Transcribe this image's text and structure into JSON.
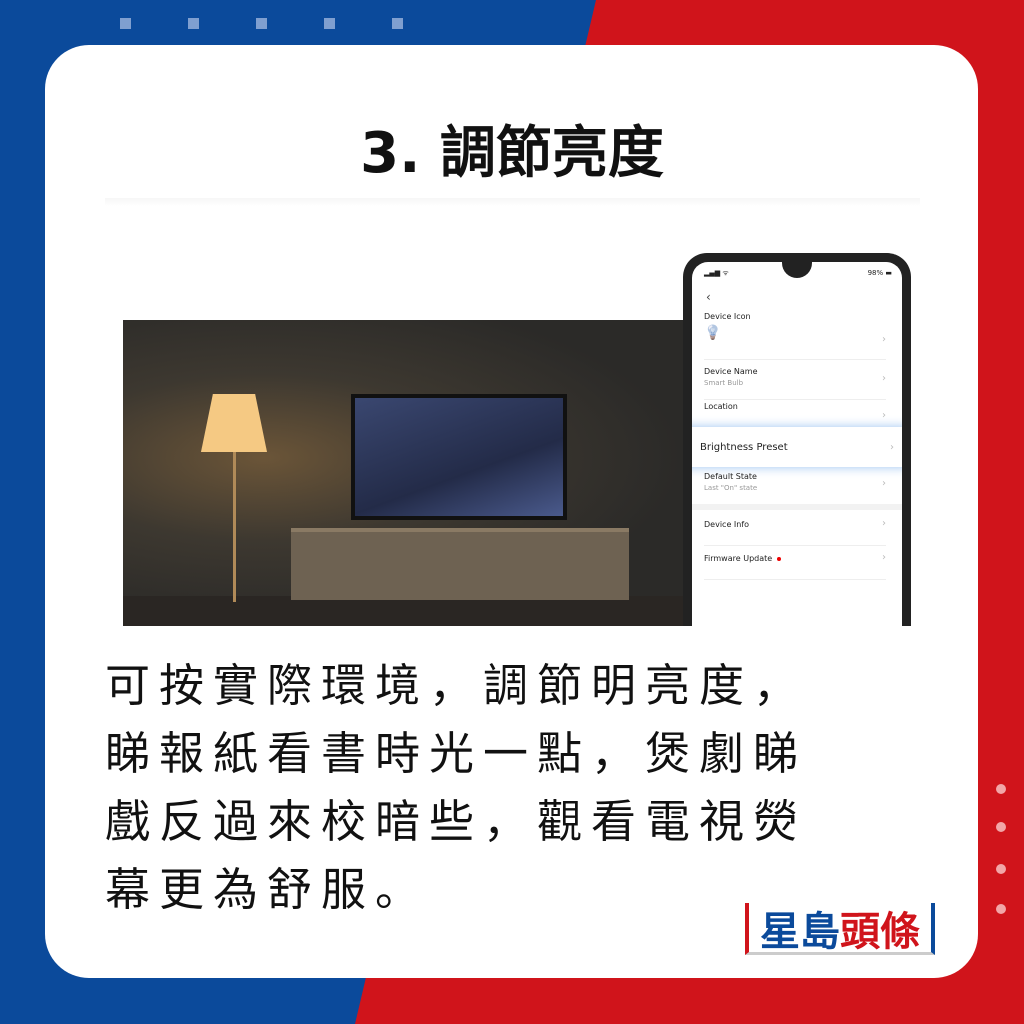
{
  "title": "3.  調節亮度",
  "body_lines": [
    "可按實際環境，調節明亮度，",
    "睇報紙看書時光一點，煲劇睇",
    "戲反過來校暗些，觀看電視熒",
    "幕更為舒服。"
  ],
  "phone": {
    "signal": "▂▄▆ ᯤ",
    "battery": "98% ▬",
    "back": "‹",
    "items": [
      {
        "label": "Device Icon",
        "sub": ""
      },
      {
        "label": "Device Name",
        "sub": "Smart Bulb"
      },
      {
        "label": "Location",
        "sub": ""
      },
      {
        "label": "Brightness Preset",
        "sub": ""
      },
      {
        "label": "Default State",
        "sub": "Last \"On\" state"
      },
      {
        "label": "Device Info",
        "sub": ""
      },
      {
        "label": "Firmware Update",
        "sub": ""
      }
    ],
    "chevron": "›",
    "bulb": "💡"
  },
  "logo": {
    "part1": "星島",
    "part2": "頭條"
  },
  "colors": {
    "blue": "#0b4a9b",
    "red": "#d0141b"
  }
}
